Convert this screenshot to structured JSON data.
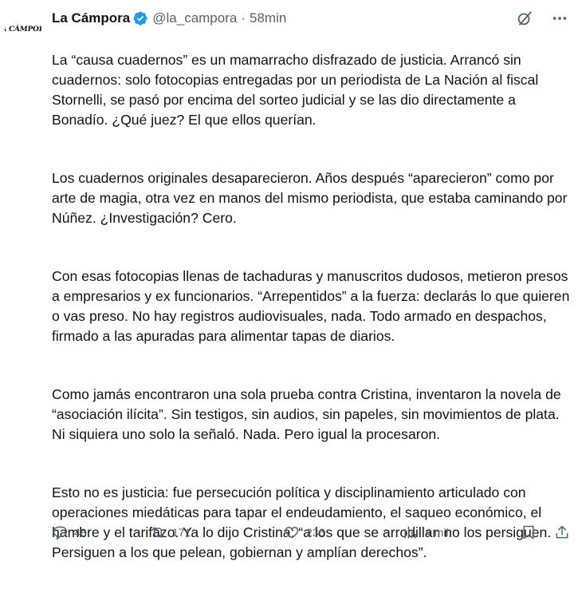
{
  "avatar": {
    "logo_text": "LA CÁMPORA"
  },
  "header": {
    "name": "La Cámpora",
    "handle": "@la_campora",
    "separator": "·",
    "time": "58min"
  },
  "tweet": {
    "paragraphs": [
      "La “causa cuadernos” es un mamarracho disfrazado de justicia. Arrancó sin cuadernos: solo fotocopias entregadas por un periodista de La Nación al fiscal Stornelli, se pasó por encima del sorteo judicial y se las dio directamente a Bonadío. ¿Qué juez? El que ellos querían.",
      "Los cuadernos originales desaparecieron. Años después “aparecieron” como por arte de magia, otra vez en manos del mismo periodista, que estaba caminando por Núñez. ¿Investigación? Cero.",
      "Con esas fotocopias llenas de tachaduras y manuscritos dudosos, metieron presos a empresarios y ex funcionarios. “Arrepentidos” a la fuerza: declarás lo que quieren o vas preso. No hay registros audiovisuales, nada. Todo armado en despachos, firmado a las apuradas para alimentar tapas de diarios.",
      "Como jamás encontraron una sola prueba contra Cristina, inventaron la novela de “asociación ilícita”. Sin testigos, sin audios, sin papeles, sin movimientos de plata. Ni siquiera uno solo la señaló. Nada. Pero igual la procesaron.",
      "Esto no es justicia: fue persecución política y disciplinamiento articulado con operaciones miedáticas para tapar el endeudamiento, el saqueo económico, el hambre y el tarifazo. Ya lo dijo Cristina: “a los que se arrodillan no los persiguen. Persiguen a los que pelean, gobiernan y amplían derechos”."
    ]
  },
  "actions": {
    "replies": "48",
    "reposts": "171",
    "likes": "236",
    "views": "4 mil"
  },
  "colors": {
    "text": "#0f1419",
    "secondary": "#536471",
    "verified": "#1d9bf0"
  }
}
